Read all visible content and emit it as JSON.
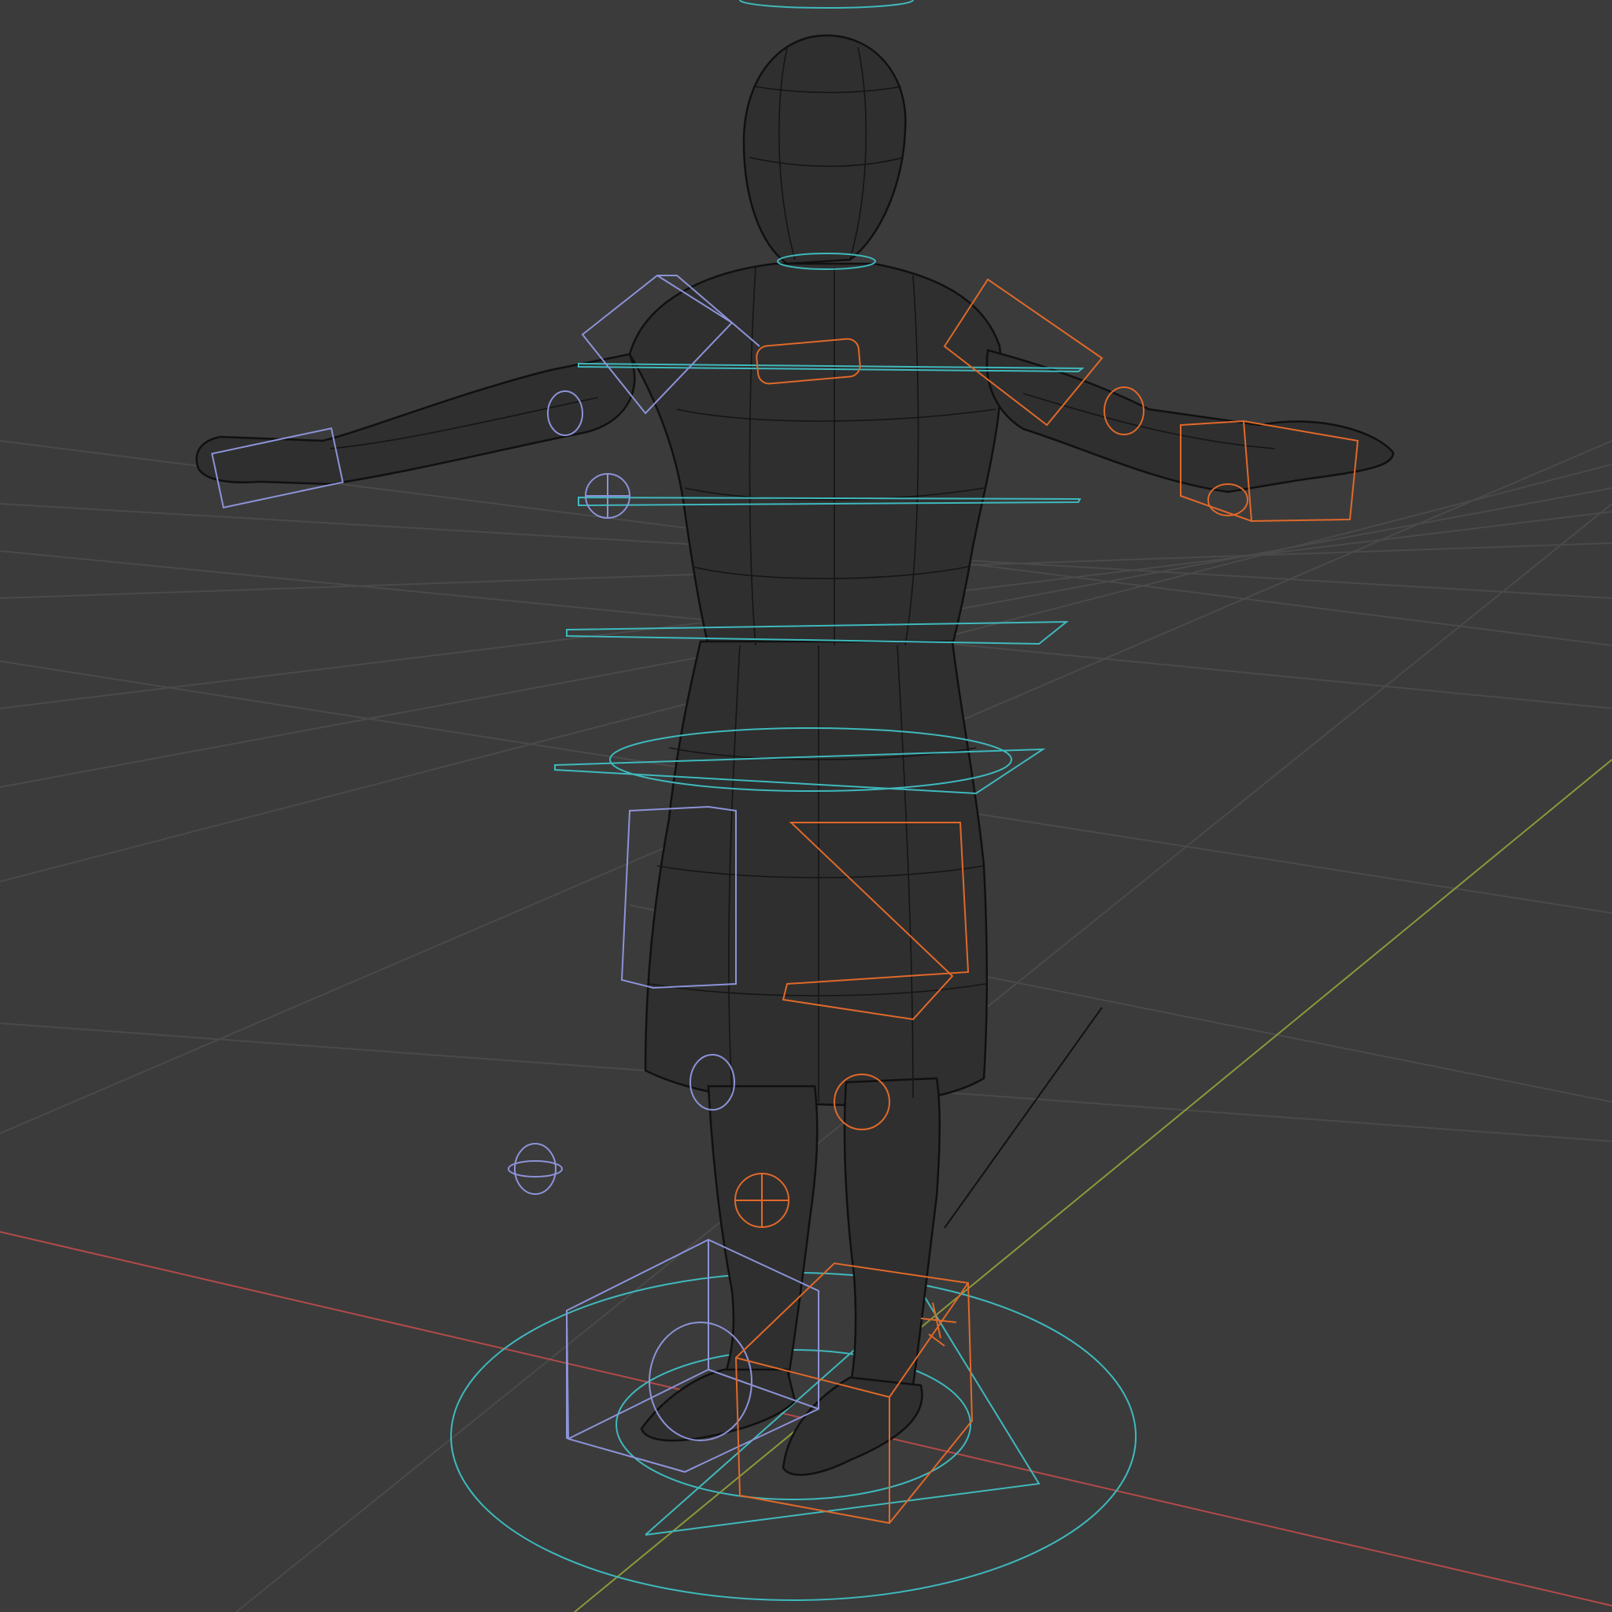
{
  "viewport": {
    "background": "#3b3b3b",
    "grid_color": "#4a4a4a",
    "axis_x_color": "#b34a4a",
    "axis_y_color": "#8a9a3a",
    "mesh_wire_color": "#151515"
  },
  "rig": {
    "center_controls_color": "#3fb9bd",
    "left_side_controls_color": "#8d93d8",
    "right_side_controls_color": "#e0692a"
  },
  "icons": [
    "wireframe-character-mesh",
    "root-circle-control",
    "ik-foot-box",
    "ik-hand-box",
    "pole-target-sphere"
  ]
}
